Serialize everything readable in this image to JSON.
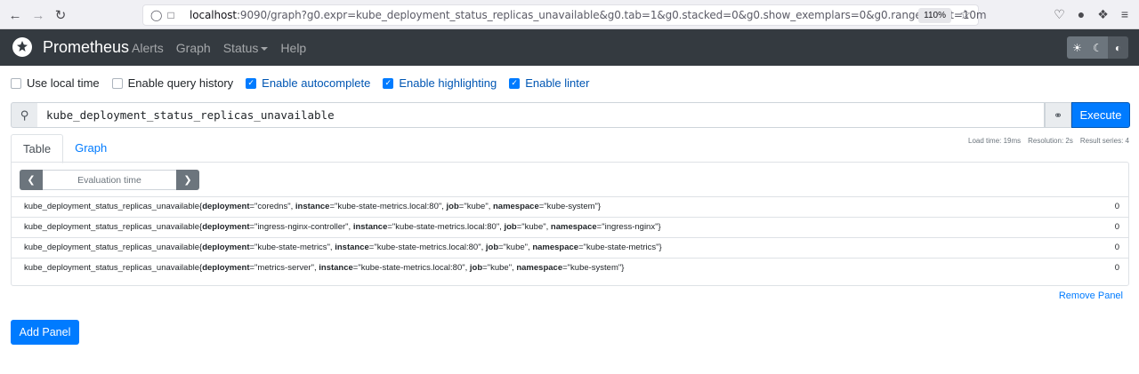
{
  "browser": {
    "url_host": "localhost",
    "url_rest": ":9090/graph?g0.expr=kube_deployment_status_replicas_unavailable&g0.tab=1&g0.stacked=0&g0.show_exemplars=0&g0.range_input=10m",
    "zoom": "110%"
  },
  "navbar": {
    "brand": "Prometheus",
    "links": [
      "Alerts",
      "Graph",
      "Status",
      "Help"
    ]
  },
  "options": [
    {
      "label": "Use local time",
      "checked": false
    },
    {
      "label": "Enable query history",
      "checked": false
    },
    {
      "label": "Enable autocomplete",
      "checked": true
    },
    {
      "label": "Enable highlighting",
      "checked": true
    },
    {
      "label": "Enable linter",
      "checked": true
    }
  ],
  "query": {
    "expression": "kube_deployment_status_replicas_unavailable",
    "execute_label": "Execute"
  },
  "tabs": [
    "Table",
    "Graph"
  ],
  "stats": {
    "load_time": "Load time: 19ms",
    "resolution": "Resolution: 2s",
    "result_series": "Result series: 4"
  },
  "eval": {
    "placeholder": "Evaluation time"
  },
  "results": [
    {
      "metric": "kube_deployment_status_replicas_unavailable",
      "deployment": "coredns",
      "instance": "kube-state-metrics.local:80",
      "job": "kube",
      "namespace": "kube-system",
      "value": "0"
    },
    {
      "metric": "kube_deployment_status_replicas_unavailable",
      "deployment": "ingress-nginx-controller",
      "instance": "kube-state-metrics.local:80",
      "job": "kube",
      "namespace": "ingress-nginx",
      "value": "0"
    },
    {
      "metric": "kube_deployment_status_replicas_unavailable",
      "deployment": "kube-state-metrics",
      "instance": "kube-state-metrics.local:80",
      "job": "kube",
      "namespace": "kube-state-metrics",
      "value": "0"
    },
    {
      "metric": "kube_deployment_status_replicas_unavailable",
      "deployment": "metrics-server",
      "instance": "kube-state-metrics.local:80",
      "job": "kube",
      "namespace": "kube-system",
      "value": "0"
    }
  ],
  "remove_panel": "Remove Panel",
  "add_panel": "Add Panel"
}
